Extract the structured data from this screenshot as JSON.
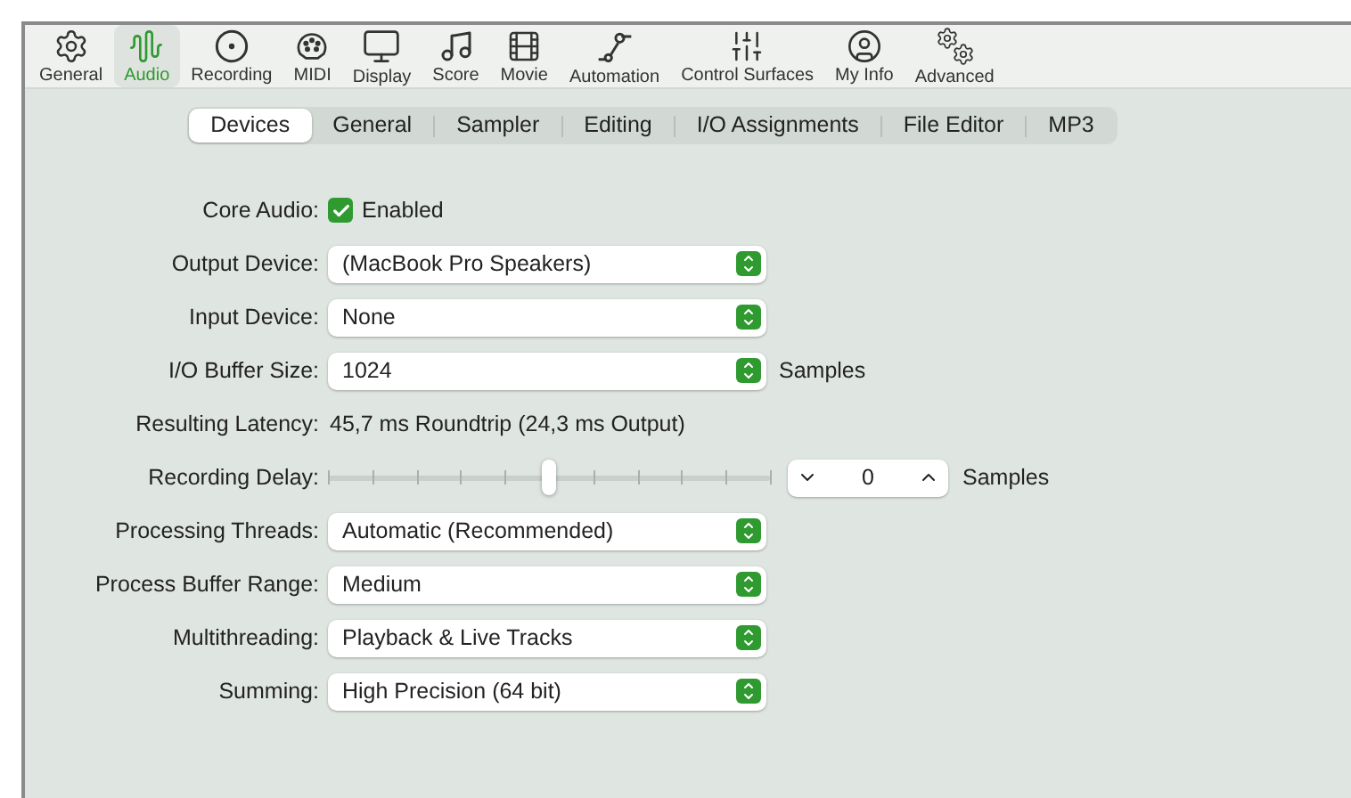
{
  "toolbar": {
    "items": [
      {
        "label": "General",
        "selected": false
      },
      {
        "label": "Audio",
        "selected": true
      },
      {
        "label": "Recording",
        "selected": false
      },
      {
        "label": "MIDI",
        "selected": false
      },
      {
        "label": "Display",
        "selected": false
      },
      {
        "label": "Score",
        "selected": false
      },
      {
        "label": "Movie",
        "selected": false
      },
      {
        "label": "Automation",
        "selected": false
      },
      {
        "label": "Control Surfaces",
        "selected": false
      },
      {
        "label": "My Info",
        "selected": false
      },
      {
        "label": "Advanced",
        "selected": false
      }
    ]
  },
  "tabs": [
    {
      "label": "Devices",
      "selected": true
    },
    {
      "label": "General",
      "selected": false
    },
    {
      "label": "Sampler",
      "selected": false
    },
    {
      "label": "Editing",
      "selected": false
    },
    {
      "label": "I/O Assignments",
      "selected": false
    },
    {
      "label": "File Editor",
      "selected": false
    },
    {
      "label": "MP3",
      "selected": false
    }
  ],
  "settings": [
    {
      "kind": "checkbox",
      "label": "Core Audio:",
      "text": "Enabled",
      "checked": true
    },
    {
      "kind": "popup",
      "label": "Output Device:",
      "value": "(MacBook Pro Speakers)"
    },
    {
      "kind": "popup",
      "label": "Input Device:",
      "value": "None"
    },
    {
      "kind": "popup",
      "label": "I/O Buffer Size:",
      "value": "1024",
      "unit": "Samples"
    },
    {
      "kind": "text",
      "label": "Resulting Latency:",
      "value": "45,7 ms Roundtrip (24,3 ms Output)"
    },
    {
      "kind": "slider",
      "label": "Recording Delay:",
      "level": 0.5,
      "value": "0",
      "unit": "Samples"
    },
    {
      "kind": "popup",
      "label": "Processing Threads:",
      "value": "Automatic (Recommended)"
    },
    {
      "kind": "popup",
      "label": "Process Buffer Range:",
      "value": "Medium"
    },
    {
      "kind": "popup",
      "label": "Multithreading:",
      "value": "Playback & Live Tracks"
    },
    {
      "kind": "popup",
      "label": "Summing:",
      "value": "High Precision (64 bit)"
    }
  ]
}
